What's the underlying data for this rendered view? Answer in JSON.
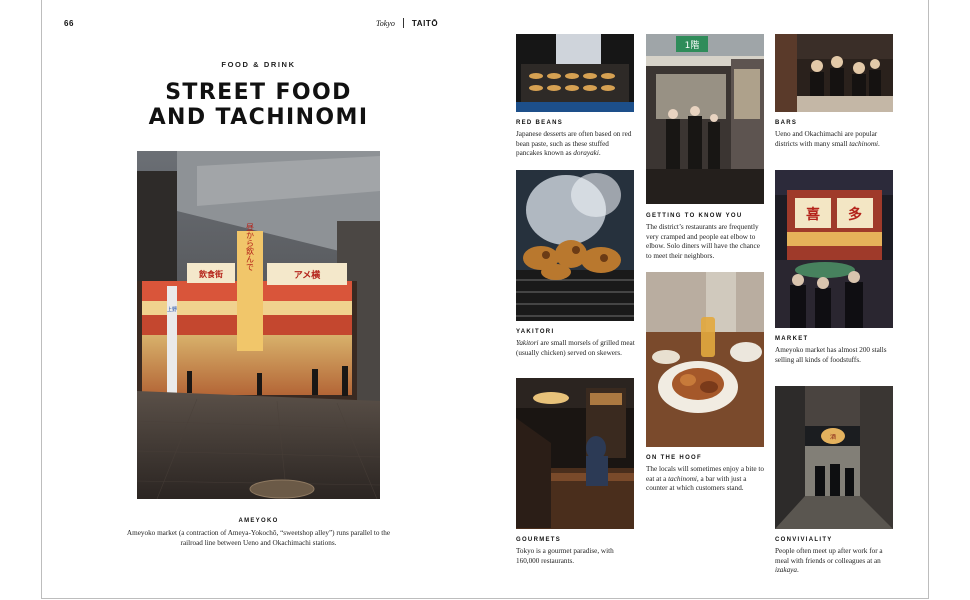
{
  "page": {
    "number": "66",
    "city": "Tokyo",
    "district": "TAITŌ",
    "kicker": "FOOD & DRINK",
    "title_line1": "STREET FOOD",
    "title_line2": "AND TACHINOMI"
  },
  "sign_text": {
    "vertical_sign": "昼から飲んで",
    "sign_main": "アメ横",
    "sign_sub": "飲食街",
    "pole_label": "上野",
    "market_sign1": "喜",
    "market_sign2": "多",
    "alley_lantern": "酒",
    "street_label": "1階"
  },
  "captions": {
    "ameyoko": {
      "title": "AMEYOKO",
      "text": "Ameyoko market (a contraction of Ameya-Yokochō, “sweetshop alley”) runs parallel to the railroad line between Ueno and Okachimachi stations."
    },
    "red_beans": {
      "title": "RED BEANS",
      "text_before": "Japanese desserts are often based on red bean paste, such as these stuffed pancakes known as ",
      "text_em": "dorayaki",
      "text_after": "."
    },
    "bars": {
      "title": "BARS",
      "text_before": "Ueno and Okachimachi are popular districts with many small ",
      "text_em": "tachinomi",
      "text_after": "."
    },
    "getting": {
      "title": "GETTING TO KNOW YOU",
      "text": "The district’s restaurants are frequently very cramped and people eat elbow to elbow. Solo diners will have the chance to meet their neighbors."
    },
    "yakitori": {
      "title": "YAKITORI",
      "text_em": "Yakitori",
      "text_after": " are small morsels of grilled meat (usually chicken) served on skewers."
    },
    "market": {
      "title": "MARKET",
      "text": "Ameyoko market has almost 200 stalls selling all kinds of foodstuffs."
    },
    "hoof": {
      "title": "ON THE HOOF",
      "text_before": "The locals will sometimes enjoy a bite to eat at a ",
      "text_em": "tachinomi",
      "text_after": ", a bar with just a counter at which customers stand."
    },
    "gourmets": {
      "title": "GOURMETS",
      "text": "Tokyo is a gourmet paradise, with 160,000 restaurants."
    },
    "conviviality": {
      "title": "CONVIVIALITY",
      "text_before": "People often meet up after work for a meal with friends or colleagues at an ",
      "text_em": "izakaya",
      "text_after": "."
    }
  }
}
